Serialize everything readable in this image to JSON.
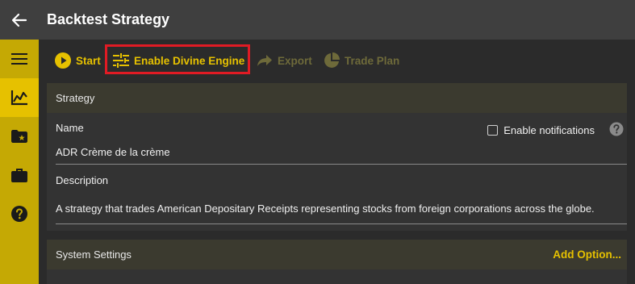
{
  "app": {
    "title": "Backtest Strategy"
  },
  "sidebar": {
    "items": [
      {
        "icon": "menu-icon"
      },
      {
        "icon": "chart-icon",
        "active": true
      },
      {
        "icon": "folder-star-icon"
      },
      {
        "icon": "briefcase-icon"
      },
      {
        "icon": "help-circle-icon"
      }
    ]
  },
  "toolbar": {
    "start_label": "Start",
    "divine_label": "Enable Divine Engine",
    "export_label": "Export",
    "tradeplan_label": "Trade Plan"
  },
  "strategy": {
    "header": "Strategy",
    "name_label": "Name",
    "name_value": "ADR Crème de la crème",
    "notifications_label": "Enable notifications",
    "notifications_checked": false,
    "description_label": "Description",
    "description_value": "A strategy that trades American Depositary Receipts representing stocks from foreign corporations across the globe."
  },
  "system_settings": {
    "header": "System Settings",
    "add_option_label": "Add Option..."
  },
  "colors": {
    "accent": "#e6c100",
    "sidebar": "#c5a904",
    "highlight": "#e01b24"
  }
}
